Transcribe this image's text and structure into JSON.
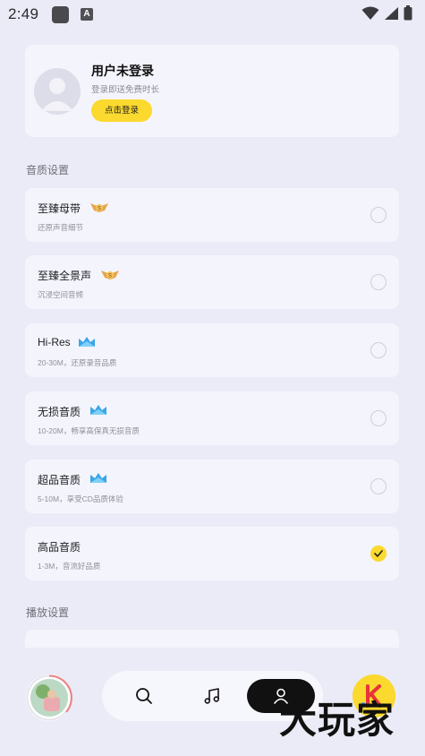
{
  "status_bar": {
    "time": "2:49",
    "icons": [
      "app-icon",
      "a-notification-icon",
      "wifi-icon",
      "signal-icon",
      "battery-icon"
    ]
  },
  "profile": {
    "name": "用户未登录",
    "subtitle": "登录即送免费时长",
    "login_button": "点击登录"
  },
  "sections": {
    "quality": "音质设置",
    "playback": "播放设置"
  },
  "quality_options": [
    {
      "title": "至臻母带",
      "desc": "还原声音细节",
      "badge": "svip-wings-badge",
      "selected": false
    },
    {
      "title": "至臻全景声",
      "desc": "沉浸空间音频",
      "badge": "svip-wings-badge",
      "selected": false
    },
    {
      "title": "Hi-Res",
      "desc": "20-30M，还原录音品质",
      "badge": "vip-crown-badge",
      "selected": false
    },
    {
      "title": "无损音质",
      "desc": "10-20M，畅享高保真无损音质",
      "badge": "vip-crown-badge",
      "selected": false
    },
    {
      "title": "超品音质",
      "desc": "5-10M，享受CD品质体验",
      "badge": "vip-crown-badge",
      "selected": false
    },
    {
      "title": "高品音质",
      "desc": "1-3M，音流好品质",
      "badge": "",
      "selected": true
    }
  ],
  "bottom_nav": {
    "items": [
      "search-icon",
      "music-note-icon",
      "profile-icon"
    ],
    "active": "profile-icon"
  },
  "watermark": "大玩家",
  "colors": {
    "accent": "#fbd92e",
    "background": "#ebebf7",
    "card": "#f4f4fc",
    "nav_active": "#111111"
  }
}
